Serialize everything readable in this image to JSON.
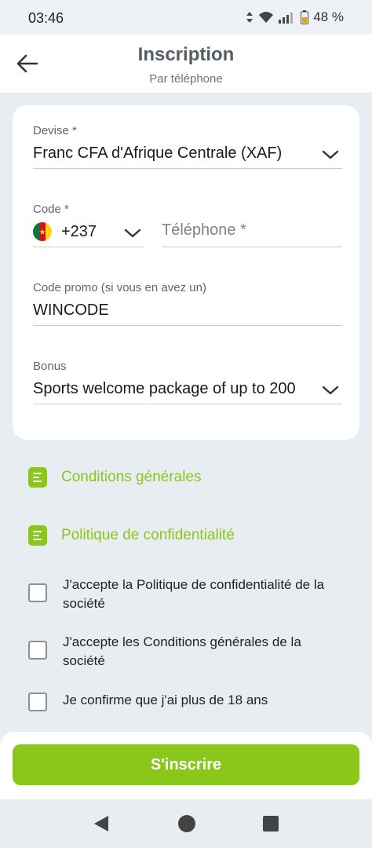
{
  "status_bar": {
    "time": "03:46",
    "battery": "48 %"
  },
  "header": {
    "title": "Inscription",
    "subtitle": "Par téléphone"
  },
  "form": {
    "currency": {
      "label": "Devise *",
      "value": "Franc CFA d'Afrique Centrale (XAF)"
    },
    "code": {
      "label": "Code *",
      "value": "+237"
    },
    "phone": {
      "placeholder": "Téléphone *"
    },
    "promo": {
      "label": "Code promo (si vous en avez un)",
      "value": "WINCODE"
    },
    "bonus": {
      "label": "Bonus",
      "value": "Sports welcome package of up to 200"
    }
  },
  "links": [
    {
      "label": "Conditions générales",
      "icon": "document-icon"
    },
    {
      "label": "Politique de confidentialité",
      "icon": "document-icon"
    }
  ],
  "checkboxes": [
    {
      "label": "J'accepte la Politique de confidentialité de la société",
      "checked": false
    },
    {
      "label": "J'accepte les Conditions générales de la société",
      "checked": false
    },
    {
      "label": "Je confirme que j'ai plus de 18 ans",
      "checked": false
    }
  ],
  "submit": {
    "label": "S'inscrire"
  },
  "colors": {
    "accent": "#8bc71a",
    "background": "#e8edf2"
  }
}
